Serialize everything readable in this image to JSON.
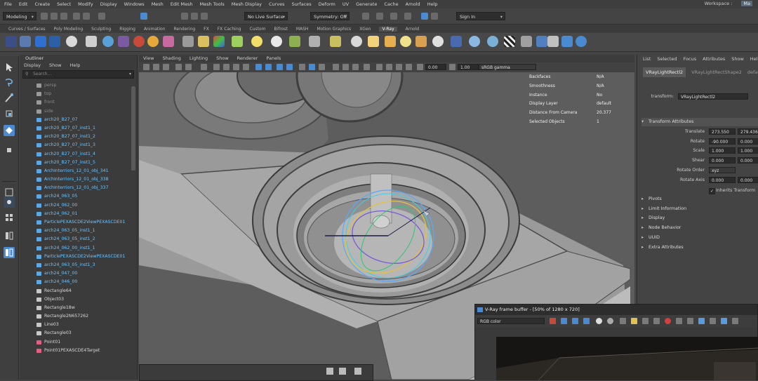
{
  "menubar": {
    "items": [
      "File",
      "Edit",
      "Create",
      "Select",
      "Modify",
      "Display",
      "Windows",
      "Mesh",
      "Edit Mesh",
      "Mesh Tools",
      "Mesh Display",
      "Curves",
      "Surfaces",
      "Deform",
      "UV",
      "Generate",
      "Cache",
      "Arnold",
      "Help"
    ],
    "workspace_label": "Workspace :",
    "workspace_value": "Ma"
  },
  "statusline": {
    "mode": "Modeling",
    "surface": "No Live Surface",
    "symmetry": "Symmetry: Off",
    "sign_in": "Sign In"
  },
  "shelf_tabs": [
    "Curves / Surfaces",
    "Poly Modeling",
    "Sculpting",
    "Rigging",
    "Animation",
    "Rendering",
    "FX",
    "FX Caching",
    "Custom",
    "Bifrost",
    "MASH",
    "Motion Graphics",
    "XGen",
    "V-Ray",
    "Arnold"
  ],
  "shelf_active_tab": "V-Ray",
  "outliner": {
    "title": "Outliner",
    "menu": [
      "Display",
      "Show",
      "Help"
    ],
    "search_placeholder": "Search...",
    "items": [
      {
        "label": "persp",
        "kind": "camera"
      },
      {
        "label": "top",
        "kind": "camera"
      },
      {
        "label": "front",
        "kind": "camera"
      },
      {
        "label": "side",
        "kind": "camera"
      },
      {
        "label": "arch20_B27_07",
        "kind": "mesh"
      },
      {
        "label": "arch20_B27_07_inst1_1",
        "kind": "mesh"
      },
      {
        "label": "arch20_B27_07_inst1_2",
        "kind": "mesh"
      },
      {
        "label": "arch20_B27_07_inst1_3",
        "kind": "mesh"
      },
      {
        "label": "arch20_B27_07_inst1_4",
        "kind": "mesh"
      },
      {
        "label": "arch20_B27_07_inst1_5",
        "kind": "mesh"
      },
      {
        "label": "ArchInterriors_12_01_obj_341",
        "kind": "mesh"
      },
      {
        "label": "ArchInterriors_12_01_obj_338",
        "kind": "mesh"
      },
      {
        "label": "ArchInterriors_12_01_obj_337",
        "kind": "mesh"
      },
      {
        "label": "arch24_063_05",
        "kind": "mesh"
      },
      {
        "label": "arch24_062_00",
        "kind": "mesh"
      },
      {
        "label": "arch24_062_01",
        "kind": "mesh"
      },
      {
        "label": "ParticlePEXASCDE2ViewPEXASCDE01",
        "kind": "mesh"
      },
      {
        "label": "arch24_063_05_inst1_1",
        "kind": "mesh"
      },
      {
        "label": "arch24_063_05_inst1_2",
        "kind": "mesh"
      },
      {
        "label": "arch24_062_00_inst1_1",
        "kind": "mesh"
      },
      {
        "label": "ParticlePEXASCDE2ViewPEXASCDE01",
        "kind": "mesh"
      },
      {
        "label": "arch24_063_05_inst1_3",
        "kind": "mesh"
      },
      {
        "label": "arch24_047_00",
        "kind": "mesh"
      },
      {
        "label": "arch24_046_00",
        "kind": "mesh"
      },
      {
        "label": "Rectangle64",
        "kind": "group"
      },
      {
        "label": "Object03",
        "kind": "group"
      },
      {
        "label": "Rectangle18w",
        "kind": "group"
      },
      {
        "label": "Rectangle2N657262",
        "kind": "group"
      },
      {
        "label": "Line03",
        "kind": "group"
      },
      {
        "label": "Rectangle03",
        "kind": "group"
      },
      {
        "label": "Point01",
        "kind": "light"
      },
      {
        "label": "Point01PEXASCDE4Target",
        "kind": "light"
      }
    ]
  },
  "viewport": {
    "menu": [
      "View",
      "Shading",
      "Lighting",
      "Show",
      "Renderer",
      "Panels"
    ],
    "field_value": "0.00",
    "field_value2": "1.00",
    "colorspace": "sRGB gamma",
    "hud": [
      {
        "key": "Backfaces",
        "value": "N/A"
      },
      {
        "key": "Smoothness",
        "value": "N/A"
      },
      {
        "key": "Instance",
        "value": "No"
      },
      {
        "key": "Display Layer",
        "value": "default"
      },
      {
        "key": "Distance From Camera",
        "value": "20.377"
      },
      {
        "key": "Selected Objects",
        "value": "1"
      }
    ]
  },
  "attribute_editor": {
    "menu": [
      "List",
      "Selected",
      "Focus",
      "Attributes",
      "Show",
      "Help"
    ],
    "tabs": [
      "VRayLightRectl2",
      "VRayLightRectShape2",
      "defau"
    ],
    "transform_label": "transform:",
    "transform_value": "VRayLightRectl2",
    "section_title": "Transform Attributes",
    "rows": [
      {
        "label": "Translate",
        "v1": "273.550",
        "v2": "279.436"
      },
      {
        "label": "Rotate",
        "v1": "-90.000",
        "v2": "0.000"
      },
      {
        "label": "Scale",
        "v1": "1.000",
        "v2": "1.000"
      },
      {
        "label": "Shear",
        "v1": "0.000",
        "v2": "0.000"
      },
      {
        "label": "Rotate Order",
        "v1": "xyz",
        "v2": ""
      },
      {
        "label": "Rotate Axis",
        "v1": "0.000",
        "v2": "0.000"
      }
    ],
    "inherits": "Inherits Transform",
    "sections": [
      "Pivots",
      "Limit Information",
      "Display",
      "Node Behavior",
      "UUID",
      "Extra Attributes"
    ]
  },
  "vfb": {
    "title": "V-Ray frame buffer - [50% of 1280 x 720]",
    "channel": "RGB color"
  },
  "colors": {
    "accent": "#4a8ad0",
    "outliner_mesh_text": "#6ec4ff",
    "outliner_group_text": "#d8d8d8"
  }
}
